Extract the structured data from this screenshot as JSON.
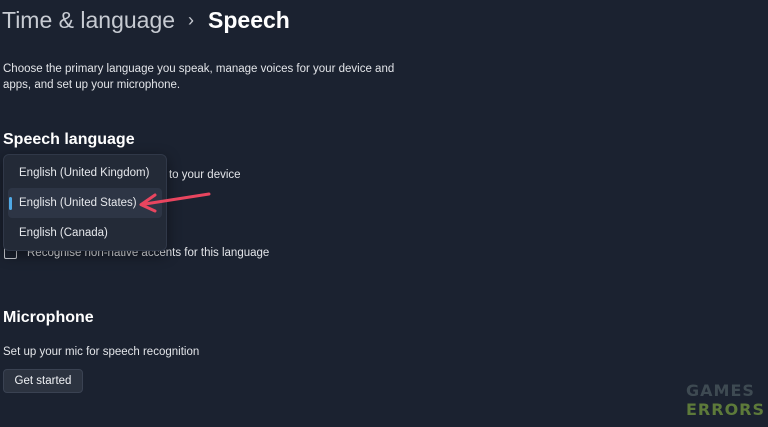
{
  "breadcrumb": {
    "parent": "Time & language",
    "separator": "›",
    "current": "Speech"
  },
  "description": "Choose the primary language you speak, manage voices for your device and apps, and set up your microphone.",
  "speech_language": {
    "title": "Speech language",
    "partial_text": "k to your device",
    "checkbox_label": "Recognise non-native accents for this language",
    "checkbox_checked": false,
    "dropdown": {
      "options": [
        {
          "label": "English (United Kingdom)",
          "selected": false
        },
        {
          "label": "English (United States)",
          "selected": true
        },
        {
          "label": "English (Canada)",
          "selected": false
        }
      ]
    }
  },
  "microphone": {
    "title": "Microphone",
    "description": "Set up your mic for speech recognition",
    "button_label": "Get started"
  },
  "watermark": {
    "line1": "GAMES",
    "line2": "ERRORS"
  },
  "colors": {
    "background": "#1b2230",
    "accent": "#4fa9e6",
    "annotation_arrow": "#e8455f"
  }
}
